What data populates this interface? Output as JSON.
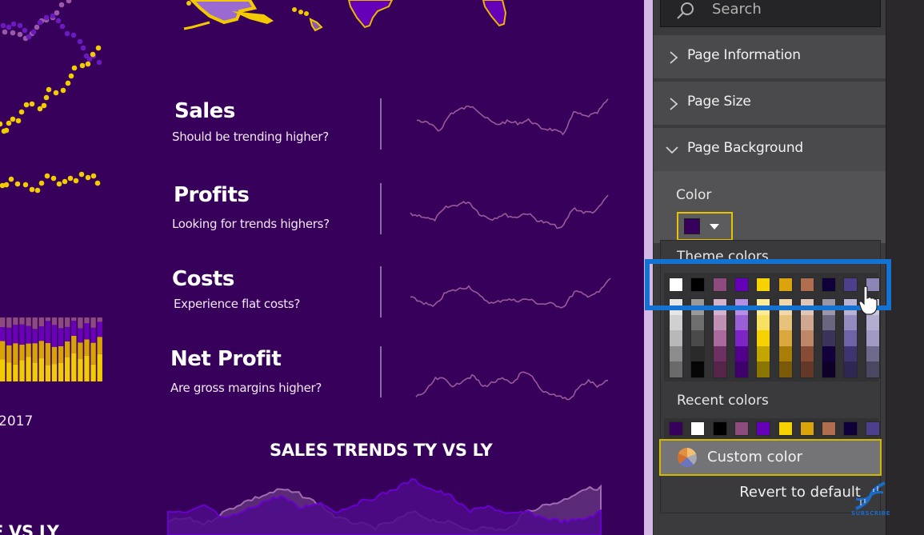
{
  "canvas": {
    "background": "#37005a",
    "kpis": [
      {
        "title": "Sales",
        "subtitle": "Should be trending higher?"
      },
      {
        "title": "Profits",
        "subtitle": "Looking for trends highers?"
      },
      {
        "title": "Costs",
        "subtitle": "Experience flat costs?"
      },
      {
        "title": "Net Profit",
        "subtitle": "Are gross margins higher?"
      }
    ],
    "year_label": "2017",
    "sales_trend_title": "SALES TRENDS TY VS LY",
    "cut_title": "E VS LY",
    "map_description": "US map fragment (Alaska, Hawaii, Texas, Florida)"
  },
  "panel": {
    "search": {
      "label": "Search",
      "icon": "search-icon"
    },
    "sections": [
      {
        "label": "Page Information",
        "state": "collapsed"
      },
      {
        "label": "Page Size",
        "state": "collapsed"
      },
      {
        "label": "Page Background",
        "state": "expanded"
      }
    ],
    "color_label": "Color",
    "current_color": "#37005a",
    "picker": {
      "theme_label": "Theme colors",
      "theme_colors": [
        "#ffffff",
        "#000000",
        "#8c4a7e",
        "#6600b8",
        "#f6d300",
        "#dba30c",
        "#b06e4e",
        "#10003a",
        "#4d3f8c",
        "#8c86b8"
      ],
      "shades": [
        [
          "#e6e6e6",
          "#d0d0d0",
          "#b8b8b8",
          "#8c8c8c",
          "#6a6a6a"
        ],
        [
          "#9a9a9a",
          "#6e6e6e",
          "#4a4a4a",
          "#2a2a2a",
          "#050505"
        ],
        [
          "#d4b4cc",
          "#c08fb4",
          "#a9699a",
          "#6e3060",
          "#542548"
        ],
        [
          "#b48fe6",
          "#9a5ed6",
          "#7d24c6",
          "#52008c",
          "#3e006a"
        ],
        [
          "#fbec99",
          "#f8e060",
          "#f6d300",
          "#c4a600",
          "#8a7500"
        ],
        [
          "#f0d8aa",
          "#e6c27a",
          "#dba840",
          "#a87d0a",
          "#7a5a08"
        ],
        [
          "#e0c6b8",
          "#d0a890",
          "#be8868",
          "#884c34",
          "#643828"
        ],
        [
          "#9a96a8",
          "#6a6680",
          "#3c3458",
          "#12003c",
          "#0c0028"
        ],
        [
          "#b8b2d4",
          "#948cc0",
          "#6f63a8",
          "#3e3470",
          "#2e2754"
        ],
        [
          "#cac8dc",
          "#b2aed0",
          "#a09ac4",
          "#6e6a8c",
          "#4a4762"
        ]
      ],
      "recent_label": "Recent colors",
      "recent_colors": [
        "#37005a",
        "#ffffff",
        "#000000",
        "#8c4a7e",
        "#6600b8",
        "#f6d300",
        "#dba30c",
        "#b06e4e",
        "#10003a",
        "#4d3f8c"
      ],
      "custom_label": "Custom color",
      "revert_label": "Revert to default"
    }
  },
  "overlay": {
    "highlight_color": "#1473d1",
    "subscribe_label": "SUBSCRIBE"
  }
}
